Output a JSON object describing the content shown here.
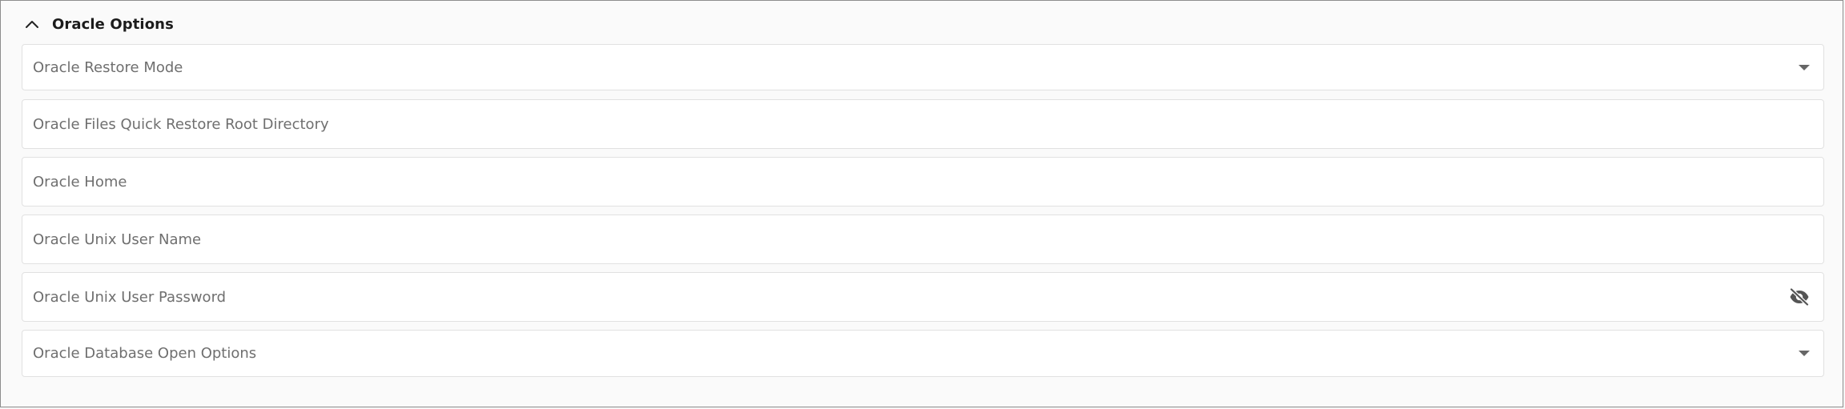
{
  "section": {
    "title": "Oracle Options",
    "expanded": true
  },
  "fields": {
    "restore_mode": {
      "label": "Oracle Restore Mode",
      "type": "select",
      "value": ""
    },
    "quick_restore_root": {
      "label": "Oracle Files Quick Restore Root Directory",
      "type": "text",
      "value": ""
    },
    "oracle_home": {
      "label": "Oracle Home",
      "type": "text",
      "value": ""
    },
    "unix_user_name": {
      "label": "Oracle Unix User Name",
      "type": "text",
      "value": ""
    },
    "unix_user_password": {
      "label": "Oracle Unix User Password",
      "type": "password",
      "value": "",
      "visibility_icon": "eye-off-icon"
    },
    "db_open_options": {
      "label": "Oracle Database Open Options",
      "type": "select",
      "value": ""
    }
  },
  "colors": {
    "border": "#e1e1e1",
    "label": "#6f6f6f",
    "title": "#1c1c1c",
    "icon": "#555555"
  }
}
